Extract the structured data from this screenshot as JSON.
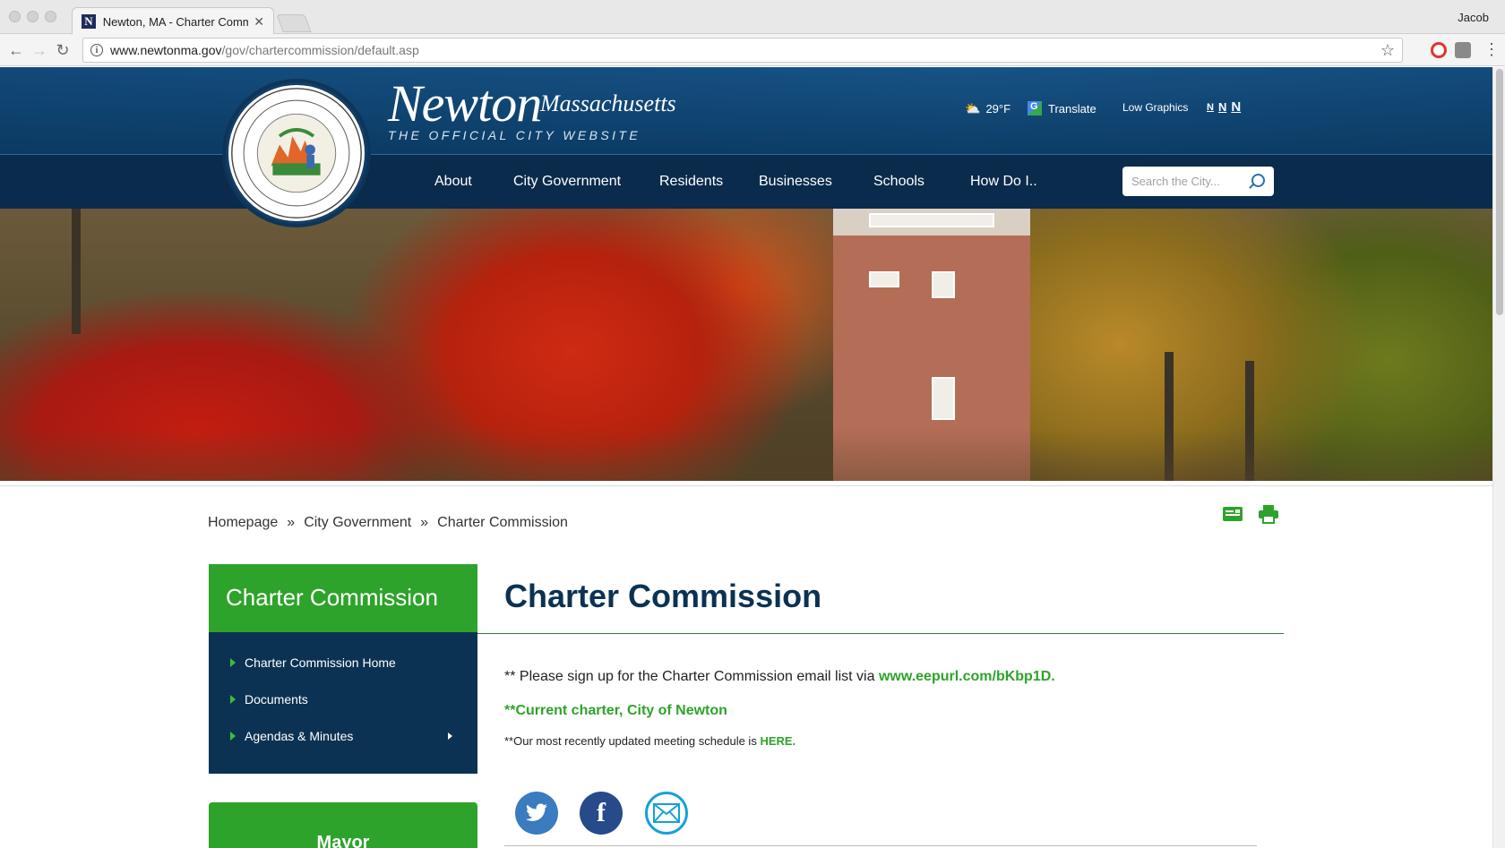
{
  "browser": {
    "tab_title": "Newton, MA - Charter Commis",
    "tab_favicon": "N",
    "user": "Jacob",
    "url_host": "www.newtonma.gov",
    "url_path": "/gov/chartercommission/default.asp"
  },
  "site": {
    "name": "Newton",
    "state": "Massachusetts",
    "tagline": "THE OFFICIAL CITY WEBSITE",
    "weather": "29°F",
    "translate": "Translate",
    "low_graphics": "Low Graphics",
    "text_sizes": [
      "N",
      "N",
      "N"
    ],
    "nav": [
      "About",
      "City Government",
      "Residents",
      "Businesses",
      "Schools",
      "How Do I.."
    ],
    "search_placeholder": "Search the City..."
  },
  "breadcrumb": [
    "Homepage",
    "City Government",
    "Charter Commission"
  ],
  "sidebar": {
    "heading": "Charter Commission",
    "items": [
      {
        "label": "Charter Commission Home"
      },
      {
        "label": "Documents"
      },
      {
        "label": "Agendas & Minutes"
      }
    ],
    "next_box": "Mayor"
  },
  "content": {
    "title": "Charter Commission",
    "p1_text": "** Please sign up for the Charter Commission email list via ",
    "p1_link": "www.eepurl.com/bKbp1D.",
    "p2_link": "**Current charter, City of Newton",
    "p3_text": "**Our most recently updated meeting schedule is ",
    "p3_link": "HERE."
  },
  "colors": {
    "brand_green": "#2ea32b",
    "navy": "#0b3252",
    "header_blue": "#0b3a63"
  },
  "icons": [
    "info-icon",
    "star-icon",
    "weather-icon",
    "translate-icon",
    "search-icon",
    "email-page-icon",
    "print-icon",
    "twitter-icon",
    "facebook-icon",
    "email-icon"
  ]
}
